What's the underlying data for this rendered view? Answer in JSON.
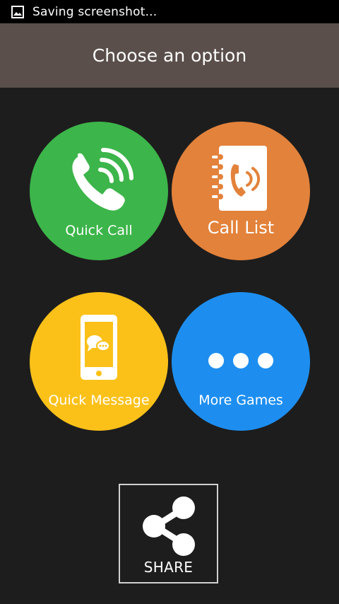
{
  "status_bar": {
    "text": "Saving screenshot...",
    "icon": "image-icon"
  },
  "header": {
    "title": "Choose an option"
  },
  "options": [
    {
      "label": "Quick Call",
      "icon": "phone-signal-icon",
      "color": "#3cb54a"
    },
    {
      "label": "Call List",
      "icon": "address-book-icon",
      "color": "#e3823b"
    },
    {
      "label": "Quick Message",
      "icon": "smartphone-message-icon",
      "color": "#fbc119"
    },
    {
      "label": "More Games",
      "icon": "more-dots-icon",
      "color": "#1d8ef0"
    }
  ],
  "share": {
    "label": "SHARE",
    "icon": "share-icon"
  },
  "colors": {
    "background": "#1d1d1d",
    "header": "#5a4f4b",
    "status_bar": "#000000"
  }
}
